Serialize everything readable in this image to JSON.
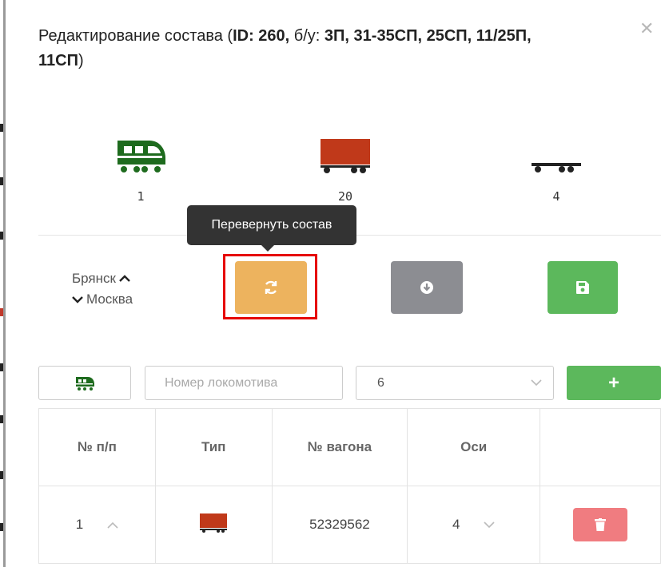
{
  "modal": {
    "title_prefix": "Редактирование состава (",
    "title_id": "ID: 260,",
    "title_bu": "б/у:",
    "title_codes": "3П, 31-35СП, 25СП, 11/25П,",
    "title_codes_2": "11СП",
    "title_suffix": ")",
    "close": "✕"
  },
  "counts": {
    "locomotive": "1",
    "wagon": "20",
    "platform": "4"
  },
  "tooltip": "Перевернуть состав",
  "route": {
    "from": "Брянск",
    "to": "Москва"
  },
  "form": {
    "loco_number_placeholder": "Номер локомотива",
    "axles_value": "6",
    "add_label": "+"
  },
  "table": {
    "headers": [
      "№ п/п",
      "Тип",
      "№ вагона",
      "Оси",
      ""
    ],
    "rows": [
      {
        "num": "1",
        "type_icon": "wagon-icon",
        "wagon": "52329562",
        "axles": "4"
      }
    ]
  },
  "colors": {
    "locomotive": "#1e6b1e",
    "wagon": "#c0391a",
    "reverse": "#edb35e",
    "download": "#8c8d92",
    "save": "#5cb85c",
    "delete": "#f07c80"
  },
  "icons": {
    "reverse": "refresh-icon",
    "download": "download-circle-icon",
    "save": "floppy-icon",
    "delete": "trash-icon"
  }
}
